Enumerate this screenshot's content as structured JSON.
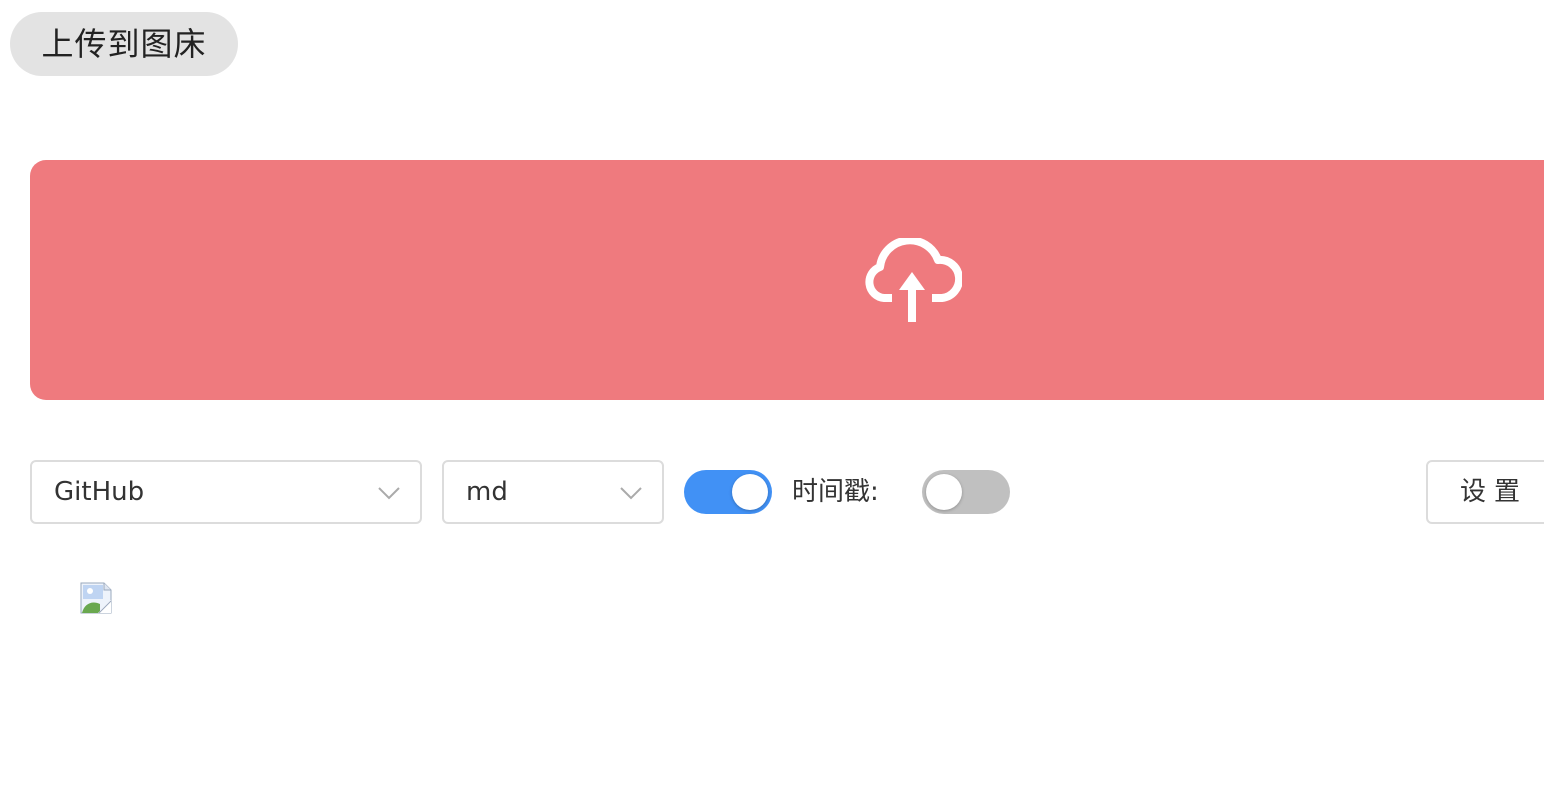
{
  "header": {
    "upload_button_label": "上传到图床"
  },
  "upload_area": {
    "icon": "cloud-upload-icon",
    "color": "#ef7a7e"
  },
  "toolbar": {
    "host_select": {
      "value": "GitHub",
      "icon": "chevron-down-icon"
    },
    "format_select": {
      "value": "md",
      "icon": "chevron-down-icon"
    },
    "toggle_a": {
      "on": true,
      "color": "#4191f5"
    },
    "timestamp_label": "时间戳:",
    "timestamp_toggle": {
      "on": false,
      "color": "#c0c0c0"
    },
    "settings_label": "设置"
  },
  "preview": {
    "icon": "broken-image-icon"
  }
}
